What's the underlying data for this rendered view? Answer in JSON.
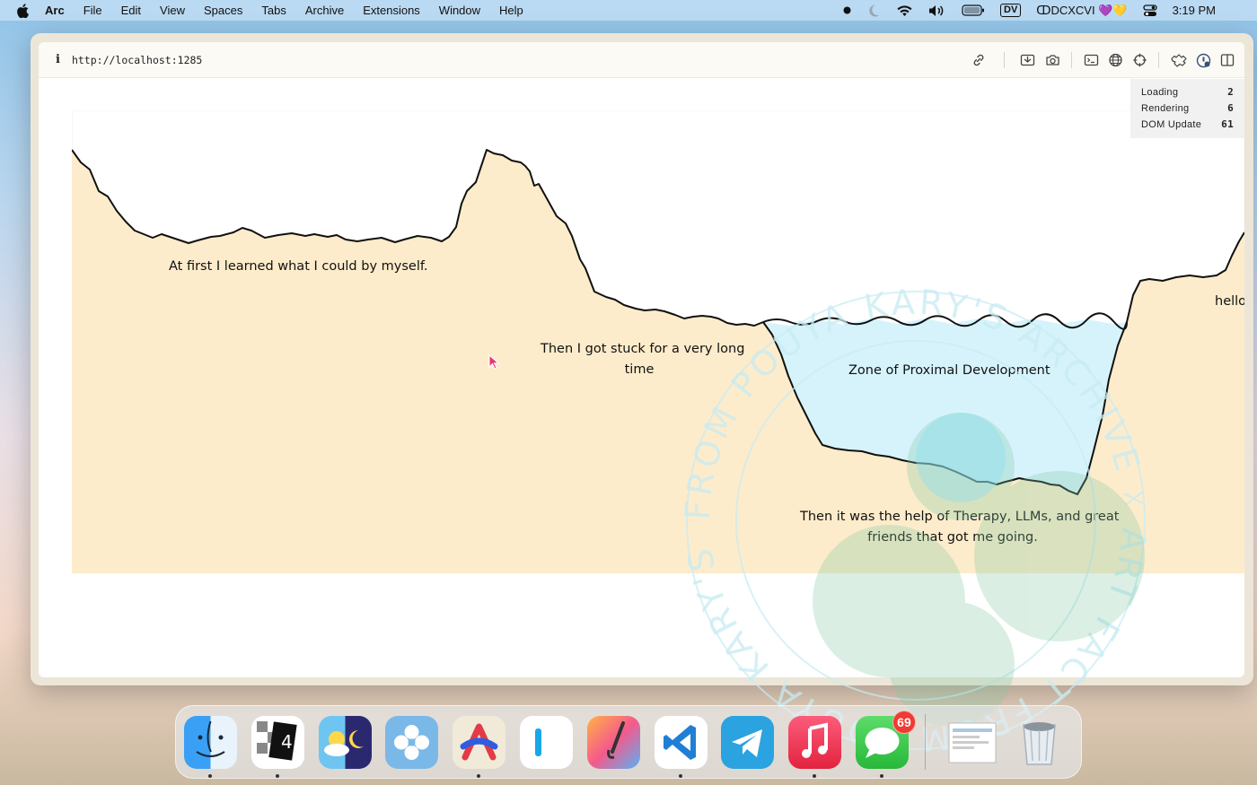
{
  "menubar": {
    "app_name": "Arc",
    "items": [
      "File",
      "Edit",
      "View",
      "Spaces",
      "Tabs",
      "Archive",
      "Extensions",
      "Window",
      "Help"
    ],
    "dv_badge": "DV",
    "user_label": "ↀDCXCVI 💜💛",
    "clock": "3:19 PM"
  },
  "browser": {
    "url": "http://localhost:1285",
    "info_icon": "i"
  },
  "perf_panel": {
    "rows": [
      {
        "label": "Loading",
        "value": "2"
      },
      {
        "label": "Rendering",
        "value": "6"
      },
      {
        "label": "DOM Update",
        "value": "61"
      }
    ]
  },
  "scene": {
    "labels": [
      "At first I learned what I could by myself.",
      "Then I got stuck for a very long",
      "time",
      "Zone of Proximal Development",
      "Then it was the help of Therapy, LLMs, and great",
      "friends that got me going.",
      "hello"
    ],
    "colors": {
      "terrain": "#fdeccb",
      "water": "#d6f3fc",
      "line": "#111111"
    }
  },
  "watermark": {
    "text": "FROM POUYA KARY'S ARCHIVE ☓ ART FACT FROM POUYA KARY'S"
  },
  "dock": {
    "apps": [
      "finder",
      "calendar-4",
      "weather",
      "perplexity",
      "arc",
      "note",
      "pixelmator",
      "vscode",
      "telegram",
      "music",
      "messages",
      "downloads",
      "trash"
    ],
    "messages_badge": "69"
  }
}
